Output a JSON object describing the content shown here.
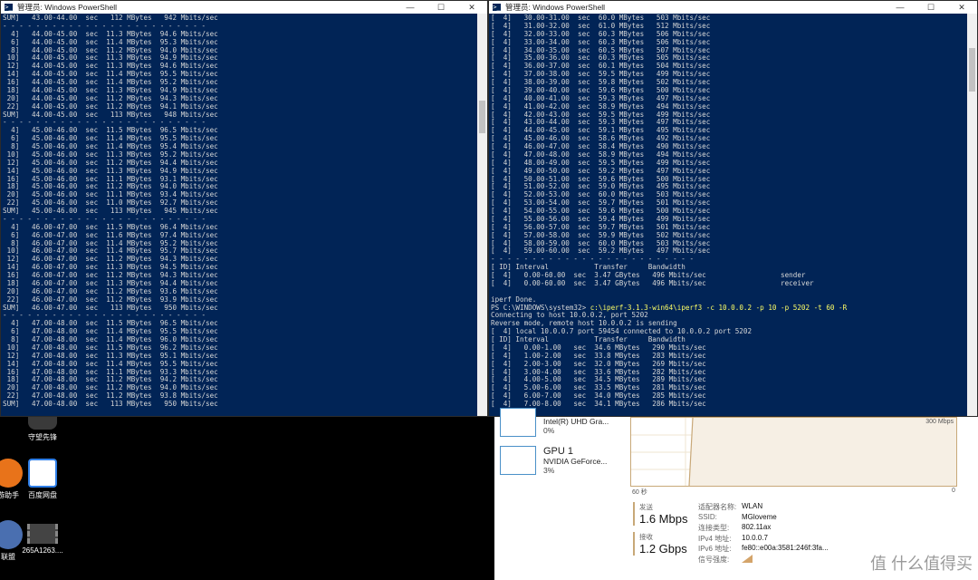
{
  "left_window": {
    "title": "管理员: Windows PowerShell",
    "controls": {
      "minimize": "—",
      "maximize": "☐",
      "close": "✕"
    },
    "lines": [
      "SUM]   43.00-44.00  sec   112 MBytes   942 Mbits/sec",
      "- - - - - - - - - - - - - - - - - - - - - - - - -",
      "  4]   44.00-45.00  sec  11.3 MBytes  94.6 Mbits/sec",
      "  6]   44.00-45.00  sec  11.4 MBytes  95.3 Mbits/sec",
      "  8]   44.00-45.00  sec  11.2 MBytes  94.0 Mbits/sec",
      " 10]   44.00-45.00  sec  11.3 MBytes  94.9 Mbits/sec",
      " 12]   44.00-45.00  sec  11.3 MBytes  94.6 Mbits/sec",
      " 14]   44.00-45.00  sec  11.4 MBytes  95.5 Mbits/sec",
      " 16]   44.00-45.00  sec  11.4 MBytes  95.2 Mbits/sec",
      " 18]   44.00-45.00  sec  11.3 MBytes  94.9 Mbits/sec",
      " 20]   44.00-45.00  sec  11.2 MBytes  94.3 Mbits/sec",
      " 22]   44.00-45.00  sec  11.2 MBytes  94.1 Mbits/sec",
      "SUM]   44.00-45.00  sec   113 MBytes   948 Mbits/sec",
      "- - - - - - - - - - - - - - - - - - - - - - - - -",
      "  4]   45.00-46.00  sec  11.5 MBytes  96.5 Mbits/sec",
      "  6]   45.00-46.00  sec  11.4 MBytes  95.5 Mbits/sec",
      "  8]   45.00-46.00  sec  11.4 MBytes  95.4 Mbits/sec",
      " 10]   45.00-46.00  sec  11.3 MBytes  95.2 Mbits/sec",
      " 12]   45.00-46.00  sec  11.2 MBytes  94.4 Mbits/sec",
      " 14]   45.00-46.00  sec  11.3 MBytes  94.9 Mbits/sec",
      " 16]   45.00-46.00  sec  11.1 MBytes  93.1 Mbits/sec",
      " 18]   45.00-46.00  sec  11.2 MBytes  94.0 Mbits/sec",
      " 20]   45.00-46.00  sec  11.1 MBytes  93.4 Mbits/sec",
      " 22]   45.00-46.00  sec  11.0 MBytes  92.7 Mbits/sec",
      "SUM]   45.00-46.00  sec   113 MBytes   945 Mbits/sec",
      "- - - - - - - - - - - - - - - - - - - - - - - - -",
      "  4]   46.00-47.00  sec  11.5 MBytes  96.4 Mbits/sec",
      "  6]   46.00-47.00  sec  11.6 MBytes  97.4 Mbits/sec",
      "  8]   46.00-47.00  sec  11.4 MBytes  95.2 Mbits/sec",
      " 10]   46.00-47.00  sec  11.4 MBytes  95.7 Mbits/sec",
      " 12]   46.00-47.00  sec  11.2 MBytes  94.3 Mbits/sec",
      " 14]   46.00-47.00  sec  11.3 MBytes  94.5 Mbits/sec",
      " 16]   46.00-47.00  sec  11.2 MBytes  94.3 Mbits/sec",
      " 18]   46.00-47.00  sec  11.3 MBytes  94.4 Mbits/sec",
      " 20]   46.00-47.00  sec  11.2 MBytes  93.6 Mbits/sec",
      " 22]   46.00-47.00  sec  11.2 MBytes  93.9 Mbits/sec",
      "SUM]   46.00-47.00  sec   113 MBytes   950 Mbits/sec",
      "- - - - - - - - - - - - - - - - - - - - - - - - -",
      "  4]   47.00-48.00  sec  11.5 MBytes  96.5 Mbits/sec",
      "  6]   47.00-48.00  sec  11.4 MBytes  95.5 Mbits/sec",
      "  8]   47.00-48.00  sec  11.4 MBytes  96.0 Mbits/sec",
      " 10]   47.00-48.00  sec  11.5 MBytes  96.2 Mbits/sec",
      " 12]   47.00-48.00  sec  11.3 MBytes  95.1 Mbits/sec",
      " 14]   47.00-48.00  sec  11.4 MBytes  95.5 Mbits/sec",
      " 16]   47.00-48.00  sec  11.1 MBytes  93.3 Mbits/sec",
      " 18]   47.00-48.00  sec  11.2 MBytes  94.2 Mbits/sec",
      " 20]   47.00-48.00  sec  11.2 MBytes  94.0 Mbits/sec",
      " 22]   47.00-48.00  sec  11.2 MBytes  93.8 Mbits/sec",
      "SUM]   47.00-48.00  sec   113 MBytes   950 Mbits/sec"
    ]
  },
  "right_window": {
    "title": "管理员: Windows PowerShell",
    "controls": {
      "minimize": "—",
      "maximize": "☐",
      "close": "✕"
    },
    "lines_before_command": [
      "[  4]   30.00-31.00  sec  60.0 MBytes   503 Mbits/sec",
      "[  4]   31.00-32.00  sec  61.0 MBytes   512 Mbits/sec",
      "[  4]   32.00-33.00  sec  60.3 MBytes   506 Mbits/sec",
      "[  4]   33.00-34.00  sec  60.3 MBytes   506 Mbits/sec",
      "[  4]   34.00-35.00  sec  60.5 MBytes   507 Mbits/sec",
      "[  4]   35.00-36.00  sec  60.3 MBytes   505 Mbits/sec",
      "[  4]   36.00-37.00  sec  60.1 MBytes   504 Mbits/sec",
      "[  4]   37.00-38.00  sec  59.5 MBytes   499 Mbits/sec",
      "[  4]   38.00-39.00  sec  59.8 MBytes   502 Mbits/sec",
      "[  4]   39.00-40.00  sec  59.6 MBytes   500 Mbits/sec",
      "[  4]   40.00-41.00  sec  59.3 MBytes   497 Mbits/sec",
      "[  4]   41.00-42.00  sec  58.9 MBytes   494 Mbits/sec",
      "[  4]   42.00-43.00  sec  59.5 MBytes   499 Mbits/sec",
      "[  4]   43.00-44.00  sec  59.3 MBytes   497 Mbits/sec",
      "[  4]   44.00-45.00  sec  59.1 MBytes   495 Mbits/sec",
      "[  4]   45.00-46.00  sec  58.6 MBytes   492 Mbits/sec",
      "[  4]   46.00-47.00  sec  58.4 MBytes   490 Mbits/sec",
      "[  4]   47.00-48.00  sec  58.9 MBytes   494 Mbits/sec",
      "[  4]   48.00-49.00  sec  59.5 MBytes   499 Mbits/sec",
      "[  4]   49.00-50.00  sec  59.2 MBytes   497 Mbits/sec",
      "[  4]   50.00-51.00  sec  59.6 MBytes   500 Mbits/sec",
      "[  4]   51.00-52.00  sec  59.0 MBytes   495 Mbits/sec",
      "[  4]   52.00-53.00  sec  60.0 MBytes   503 Mbits/sec",
      "[  4]   53.00-54.00  sec  59.7 MBytes   501 Mbits/sec",
      "[  4]   54.00-55.00  sec  59.6 MBytes   500 Mbits/sec",
      "[  4]   55.00-56.00  sec  59.4 MBytes   499 Mbits/sec",
      "[  4]   56.00-57.00  sec  59.7 MBytes   501 Mbits/sec",
      "[  4]   57.00-58.00  sec  59.9 MBytes   502 Mbits/sec",
      "[  4]   58.00-59.00  sec  60.0 MBytes   503 Mbits/sec",
      "[  4]   59.00-60.00  sec  59.2 MBytes   497 Mbits/sec",
      "- - - - - - - - - - - - - - - - - - - - - - - - -",
      "[ ID] Interval           Transfer     Bandwidth",
      "[  4]   0.00-60.00  sec  3.47 GBytes   496 Mbits/sec                  sender",
      "[  4]   0.00-60.00  sec  3.47 GBytes   496 Mbits/sec                  receiver",
      "",
      "iperf Done.",
      "PS C:\\WINDOWS\\system32> "
    ],
    "command": "c:\\iperf-3.1.3-win64\\iperf3 -c 10.0.0.2 -p 10 -p 5202 -t 60 -R",
    "lines_after_command": [
      "Connecting to host 10.0.0.2, port 5202",
      "Reverse mode, remote host 10.0.0.2 is sending",
      "[  4] local 10.0.0.7 port 59454 connected to 10.0.0.2 port 5202",
      "[ ID] Interval           Transfer     Bandwidth",
      "[  4]   0.00-1.00   sec  34.6 MBytes   290 Mbits/sec",
      "[  4]   1.00-2.00   sec  33.8 MBytes   283 Mbits/sec",
      "[  4]   2.00-3.00   sec  32.0 MBytes   269 Mbits/sec",
      "[  4]   3.00-4.00   sec  33.6 MBytes   282 Mbits/sec",
      "[  4]   4.00-5.00   sec  34.5 MBytes   289 Mbits/sec",
      "[  4]   5.00-6.00   sec  33.5 MBytes   281 Mbits/sec",
      "[  4]   6.00-7.00   sec  34.0 MBytes   285 Mbits/sec",
      "[  4]   7.00-8.00   sec  34.1 MBytes   286 Mbits/sec"
    ]
  },
  "desktop": {
    "icons": [
      {
        "label": "守望先锋",
        "color": "#3a3a3a"
      },
      {
        "label": "游助手",
        "color": "#e8731a"
      },
      {
        "label": "百度网盘",
        "color": "#2f7fe8"
      },
      {
        "label": "联盟",
        "color": "#4a6fb0"
      },
      {
        "label": "265A1263....",
        "color": "#444444"
      }
    ]
  },
  "task_manager": {
    "gpu0_name": "Intel(R) UHD Gra...",
    "gpu0_usage": "0%",
    "gpu1_title": "GPU 1",
    "gpu1_name": "NVIDIA GeForce...",
    "gpu1_usage": "3%",
    "graph_max_label": "300 Mbps",
    "graph_time_label": "60 秒",
    "graph_zero_label": "0",
    "send_label": "发送",
    "send_value": "1.6 Mbps",
    "recv_label": "接收",
    "recv_value": "1.2 Gbps",
    "props": [
      {
        "key": "适配器名称:",
        "value": "WLAN"
      },
      {
        "key": "SSID:",
        "value": "MGloveme"
      },
      {
        "key": "连接类型:",
        "value": "802.11ax"
      },
      {
        "key": "IPv4 地址:",
        "value": "10.0.0.7"
      },
      {
        "key": "IPv6 地址:",
        "value": "fe80::e00a:3581:246f:3fa..."
      },
      {
        "key": "信号强度:",
        "value": ""
      }
    ]
  },
  "watermark": {
    "text": "值 什么值得买"
  },
  "colors": {
    "ps_bg": "#012456",
    "ps_text": "#d7d7d7",
    "ps_cmd": "#ffff66",
    "graph_line": "#c8a878"
  }
}
